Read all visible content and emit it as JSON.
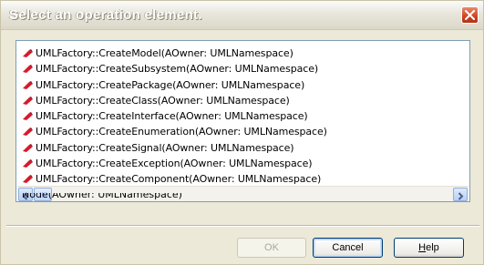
{
  "dialog": {
    "title": "Select an operation element.",
    "close_icon": "close-icon"
  },
  "operations": [
    {
      "label": "UMLFactory::CreateModel(AOwner: UMLNamespace)"
    },
    {
      "label": "UMLFactory::CreateSubsystem(AOwner: UMLNamespace)"
    },
    {
      "label": "UMLFactory::CreatePackage(AOwner: UMLNamespace)"
    },
    {
      "label": "UMLFactory::CreateClass(AOwner: UMLNamespace)"
    },
    {
      "label": "UMLFactory::CreateInterface(AOwner: UMLNamespace)"
    },
    {
      "label": "UMLFactory::CreateEnumeration(AOwner: UMLNamespace)"
    },
    {
      "label": "UMLFactory::CreateSignal(AOwner: UMLNamespace)"
    },
    {
      "label": "UMLFactory::CreateException(AOwner: UMLNamespace)"
    },
    {
      "label": "UMLFactory::CreateComponent(AOwner: UMLNamespace)"
    }
  ],
  "partial_row_text": "Node(AOwner: UMLNamespace)",
  "buttons": {
    "ok": "OK",
    "cancel": "Cancel",
    "help_first": "H",
    "help_rest": "elp"
  },
  "colors": {
    "dialog_bg": "#ece9d8",
    "list_border": "#7f9db9",
    "button_border": "#003c74",
    "close_red": "#cc4420"
  }
}
